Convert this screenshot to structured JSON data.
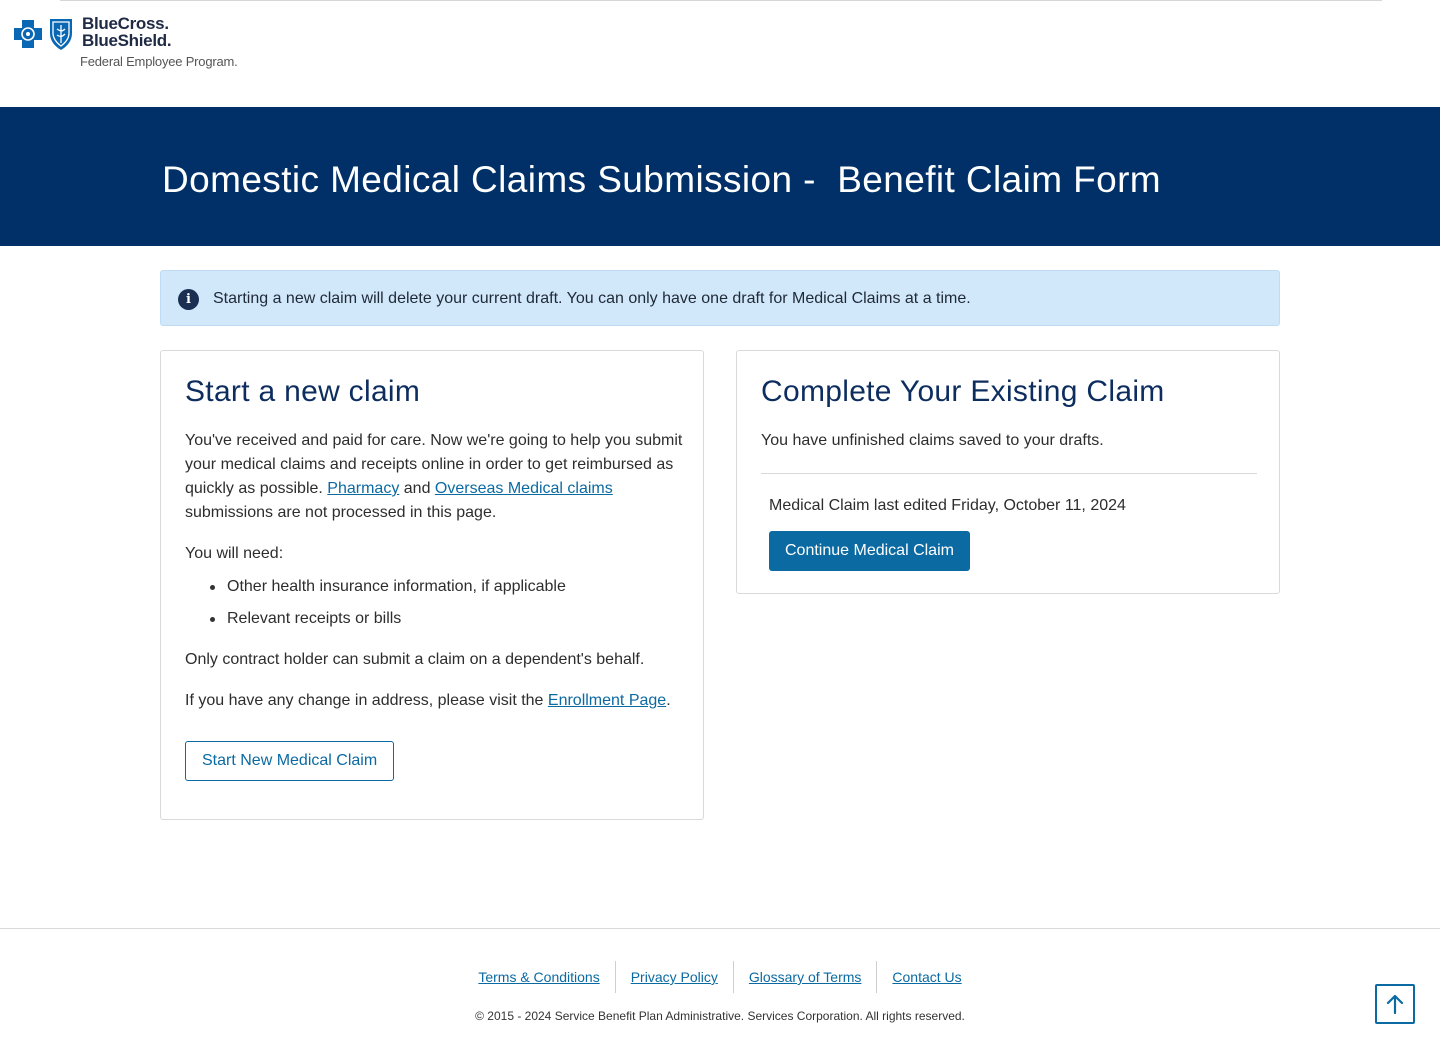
{
  "logo": {
    "line1": "BlueCross.",
    "line2": "BlueShield.",
    "line3": "Federal Employee Program.",
    "colors": {
      "navy": "#1f2a44",
      "blue": "#0a67b4"
    },
    "icons": [
      "blue-cross-icon",
      "blue-shield-icon"
    ]
  },
  "banner": {
    "title": "Domestic Medical Claims Submission -  Benefit Claim Form",
    "background": "#003067"
  },
  "alert": {
    "icon": "info-icon",
    "text": "Starting a new claim will delete your current draft. You can only have one draft for Medical Claims at a time.",
    "background": "#d1e8fa"
  },
  "new_claim": {
    "title": "Start a new claim",
    "intro_1": "You've received and paid for care. Now we're going to help you submit your medical claims and receipts online in order to get reimbursed as quickly as possible. ",
    "pharmacy_link": "Pharmacy",
    "and": " and ",
    "overseas_link": "Overseas Medical claims",
    "intro_2": " submissions are not processed in this page.",
    "need_label": "You will need:",
    "needs": [
      "Other health insurance information, if applicable",
      "Relevant receipts or bills"
    ],
    "contract_note": "Only contract holder can submit a claim on a dependent's behalf.",
    "address_note": "If you have any change in address, please visit the ",
    "enrollment_link": "Enrollment Page",
    "address_end": ".",
    "button": "Start New Medical Claim"
  },
  "existing_claim": {
    "title": "Complete Your Existing Claim",
    "subtitle": "You have unfinished claims saved to your drafts.",
    "last_edited": "Medical Claim last edited Friday, October 11, 2024",
    "button": "Continue Medical Claim"
  },
  "footer": {
    "links": [
      "Terms & Conditions",
      "Privacy Policy",
      "Glossary of Terms",
      "Contact Us"
    ],
    "copyright": "© 2015 - 2024 Service Benefit Plan Administrative. Services Corporation. All rights reserved.",
    "back_to_top_icon": "arrow-up-icon"
  },
  "colors": {
    "link": "#0b6aa2",
    "heading": "#0d2d5e",
    "primary_button": "#0b6aa2"
  }
}
